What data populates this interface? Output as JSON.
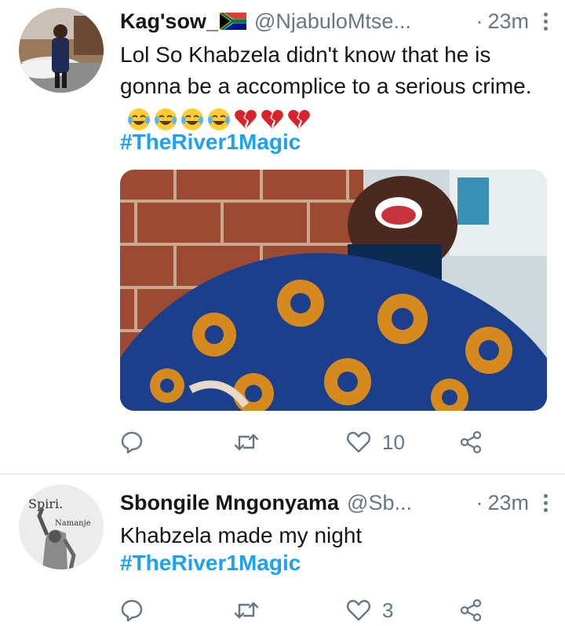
{
  "tweets": [
    {
      "author_name": "Kag'sow_",
      "handle": "@NjabuloMtse...",
      "separator": "·",
      "time": "23m",
      "text": "Lol So Khabzela didn't know that he is gonna be a accomplice to a serious crime.",
      "emojis": [
        "face-with-tears-of-joy-icon",
        "face-with-tears-of-joy-icon",
        "face-with-tears-of-joy-icon",
        "face-with-tears-of-joy-icon",
        "broken-heart-icon",
        "broken-heart-icon",
        "broken-heart-icon"
      ],
      "hashtag": "#TheRiver1Magic",
      "likes": "10"
    },
    {
      "author_name": "Sbongile Mngonyama",
      "handle": "@Sb...",
      "separator": "·",
      "time": "23m",
      "text": "Khabzela made my night",
      "hashtag": "#TheRiver1Magic",
      "likes": "3",
      "avatar_text_1": "Spiri.",
      "avatar_text_2": "Namanje"
    }
  ],
  "colors": {
    "accent": "#1da1f2",
    "muted": "#657786",
    "text": "#14171a",
    "divider": "#dfe3e6"
  }
}
